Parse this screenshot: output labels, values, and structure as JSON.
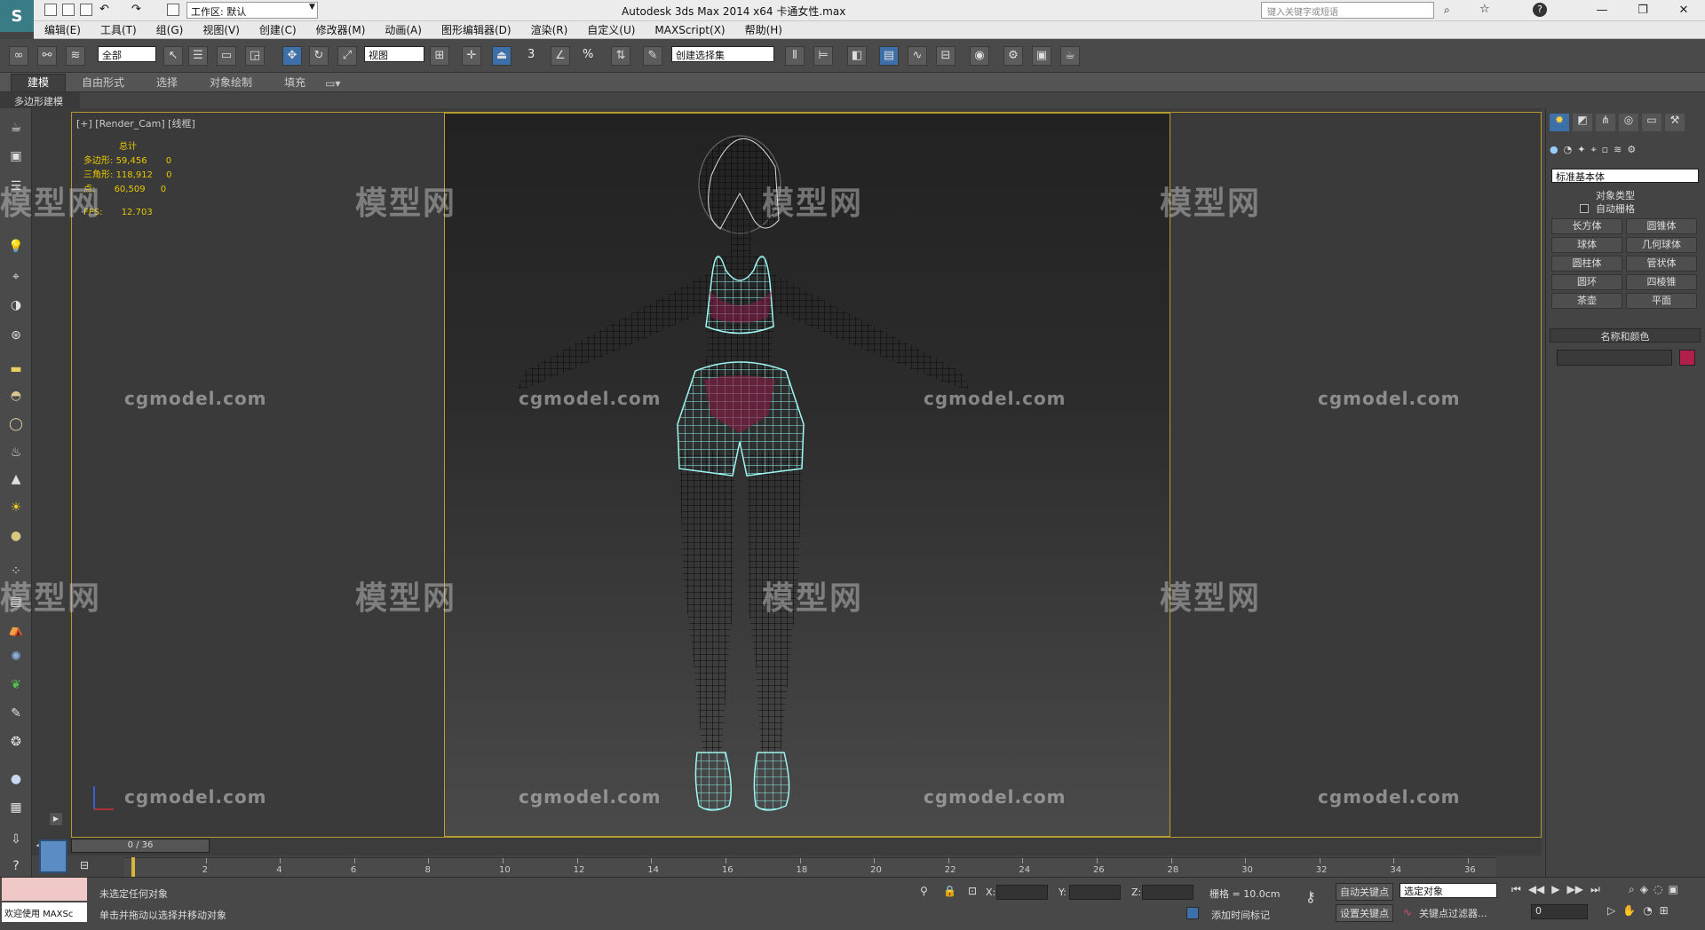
{
  "titlebar": {
    "workspace": "工作区: 默认",
    "title": "Autodesk 3ds Max  2014 x64      卡通女性.max",
    "search_placeholder": "键入关键字或短语",
    "min": "—",
    "max": "❐",
    "close": "✕",
    "help": "?"
  },
  "menu": [
    "编辑(E)",
    "工具(T)",
    "组(G)",
    "视图(V)",
    "创建(C)",
    "修改器(M)",
    "动画(A)",
    "图形编辑器(D)",
    "渲染(R)",
    "自定义(U)",
    "MAXScript(X)",
    "帮助(H)"
  ],
  "toolbar": {
    "filter": "全部",
    "coord": "视图",
    "selset": "创建选择集",
    "num3": "3",
    "pct": "%"
  },
  "ribbon": {
    "tabs": [
      "建模",
      "自由形式",
      "选择",
      "对象绘制",
      "填充"
    ],
    "active": "建模",
    "sub": "多边形建模"
  },
  "viewport": {
    "label": "[+] [Render_Cam] [线框]",
    "stats": {
      "header": "总计",
      "rows": [
        {
          "label": "多边形:",
          "value": "59,456",
          "sel": "0"
        },
        {
          "label": "三角形:",
          "value": "118,912",
          "sel": "0"
        },
        {
          "label": "点:",
          "value": "60,509",
          "sel": "0"
        }
      ],
      "fps_label": "FPS:",
      "fps": "12.703"
    },
    "watermark_cn": "模型网",
    "watermark_en": "cgmodel.com"
  },
  "cmdpanel": {
    "dropdown": "标准基本体",
    "rollout_type": "对象类型",
    "autogrid": "自动栅格",
    "buttons": [
      "长方体",
      "圆锥体",
      "球体",
      "几何球体",
      "圆柱体",
      "管状体",
      "圆环",
      "四棱锥",
      "茶壶",
      "平面"
    ],
    "rollout_name": "名称和颜色",
    "color": "#b0204a"
  },
  "timeline": {
    "slider": "0 / 36",
    "ticks": [
      "0",
      "2",
      "4",
      "6",
      "8",
      "10",
      "12",
      "14",
      "16",
      "18",
      "20",
      "22",
      "24",
      "26",
      "28",
      "30",
      "32",
      "34",
      "36"
    ],
    "prev": "<",
    "next": ">"
  },
  "status": {
    "welcome": "欢迎使用 MAXSc",
    "line1": "未选定任何对象",
    "line2": "单击并拖动以选择并移动对象",
    "x_label": "X:",
    "y_label": "Y:",
    "z_label": "Z:",
    "grid": "栅格 = 10.0cm",
    "autokey": "自动关键点",
    "setkey": "设置关键点",
    "selected": "选定对象",
    "keyfilter": "关键点过滤器...",
    "addtime": "添加时间标记",
    "frame": "0"
  }
}
